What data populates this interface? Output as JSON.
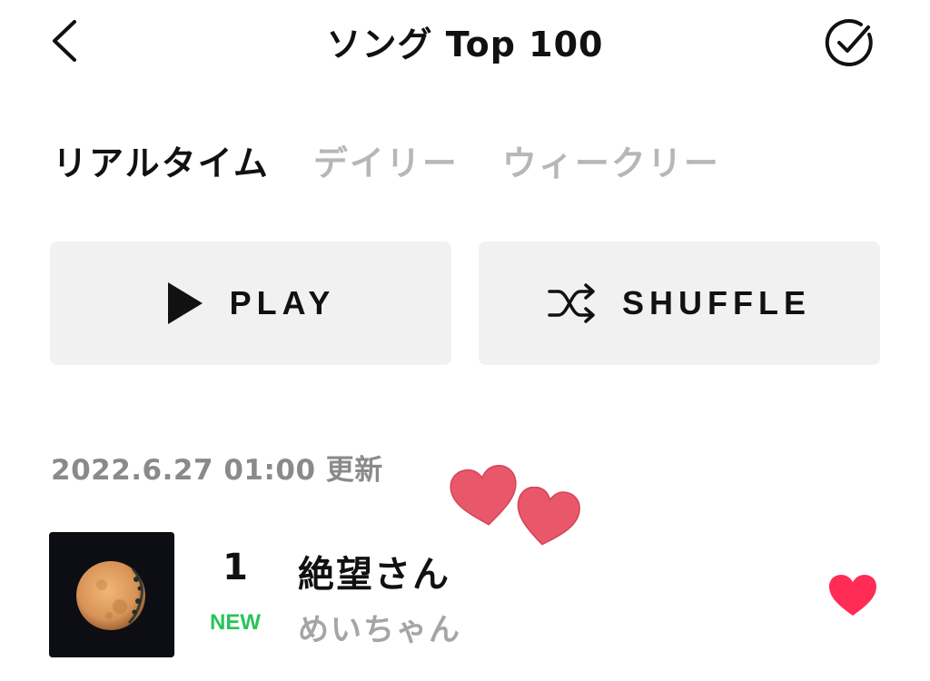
{
  "header": {
    "title": "ソング Top 100",
    "back_icon": "chevron-left-icon",
    "select_icon": "check-circle-icon"
  },
  "tabs": [
    {
      "label": "リアルタイム",
      "active": true
    },
    {
      "label": "デイリー",
      "active": false
    },
    {
      "label": "ウィークリー",
      "active": false
    }
  ],
  "actions": {
    "play_label": "PLAY",
    "play_icon": "play-icon",
    "shuffle_label": "SHUFFLE",
    "shuffle_icon": "shuffle-icon"
  },
  "updated_text": "2022.6.27 01:00 更新",
  "songs": [
    {
      "rank": "1",
      "badge": "NEW",
      "title": "絶望さん",
      "artist": "めいちゃん",
      "liked": true
    }
  ],
  "colors": {
    "accent_like": "#ff2d55",
    "new_badge": "#27c45a",
    "sticker_heart": "#e8576a",
    "button_bg": "#f1f1f1",
    "inactive_tab": "#b7b7b7"
  }
}
